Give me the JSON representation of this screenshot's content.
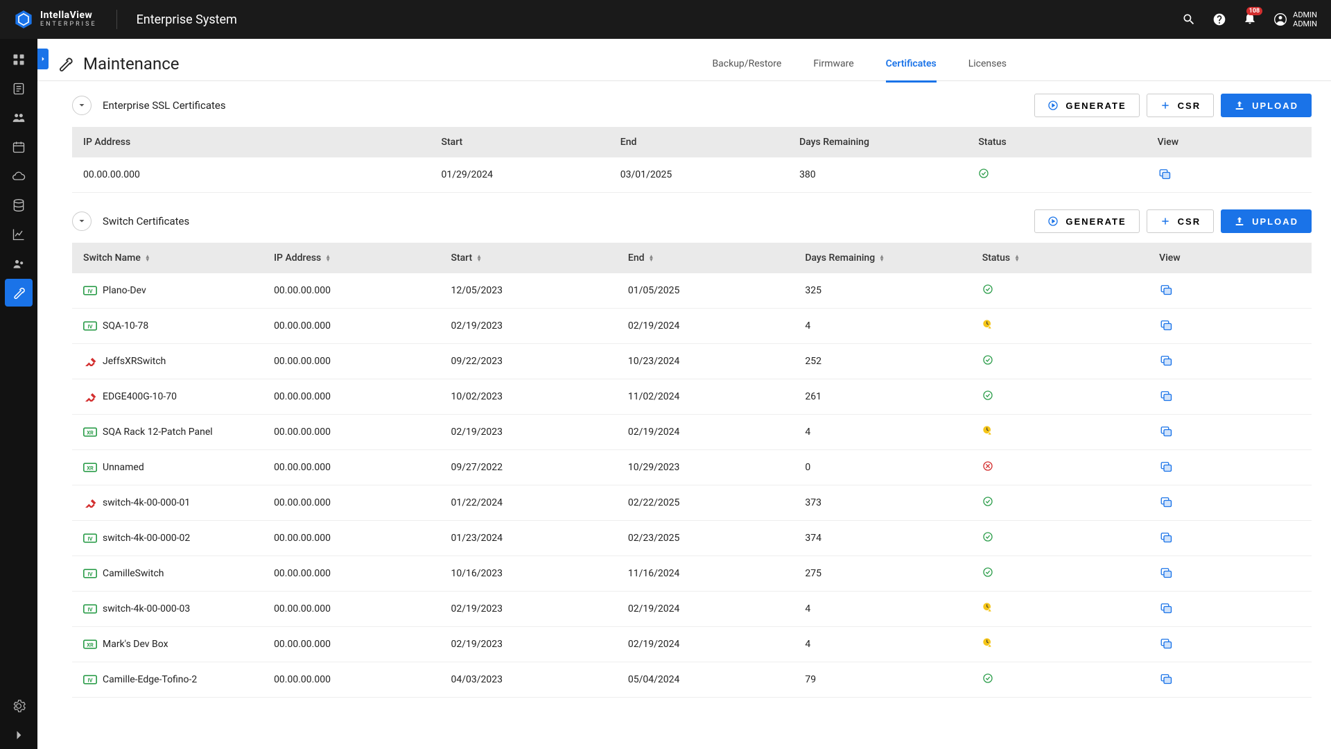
{
  "brand": {
    "name": "IntellaView",
    "sub": "ENTERPRISE"
  },
  "header": {
    "title": "Enterprise System",
    "notif_count": "108"
  },
  "user": {
    "line1": "ADMIN",
    "line2": "ADMIN"
  },
  "page": {
    "title": "Maintenance"
  },
  "tabs": {
    "backup": "Backup/Restore",
    "firmware": "Firmware",
    "certificates": "Certificates",
    "licenses": "Licenses"
  },
  "buttons": {
    "generate": "GENERATE",
    "csr": "CSR",
    "upload": "UPLOAD"
  },
  "sections": {
    "enterprise": {
      "title": "Enterprise SSL Certificates",
      "headers": {
        "ip": "IP Address",
        "start": "Start",
        "end": "End",
        "days": "Days Remaining",
        "status": "Status",
        "view": "View"
      },
      "rows": [
        {
          "ip": "00.00.00.000",
          "start": "01/29/2024",
          "end": "03/01/2025",
          "days": "380",
          "status": "ok"
        }
      ]
    },
    "switch": {
      "title": "Switch Certificates",
      "headers": {
        "switch": "Switch Name",
        "ip": "IP Address",
        "start": "Start",
        "end": "End",
        "days": "Days Remaining",
        "status": "Status",
        "view": "View"
      },
      "rows": [
        {
          "icon": "iv-green",
          "name": "Plano-Dev",
          "ip": "00.00.00.000",
          "start": "12/05/2023",
          "end": "01/05/2025",
          "days": "325",
          "status": "ok"
        },
        {
          "icon": "iv-green",
          "name": "SQA-10-78",
          "ip": "00.00.00.000",
          "start": "02/19/2023",
          "end": "02/19/2024",
          "days": "4",
          "status": "warn"
        },
        {
          "icon": "plug-red",
          "name": "JeffsXRSwitch",
          "ip": "00.00.00.000",
          "start": "09/22/2023",
          "end": "10/23/2024",
          "days": "252",
          "status": "ok"
        },
        {
          "icon": "plug-red",
          "name": "EDGE400G-10-70",
          "ip": "00.00.00.000",
          "start": "10/02/2023",
          "end": "11/02/2024",
          "days": "261",
          "status": "ok"
        },
        {
          "icon": "xr-green",
          "name": "SQA Rack 12-Patch Panel",
          "ip": "00.00.00.000",
          "start": "02/19/2023",
          "end": "02/19/2024",
          "days": "4",
          "status": "warn"
        },
        {
          "icon": "xr-green",
          "name": "Unnamed",
          "ip": "00.00.00.000",
          "start": "09/27/2022",
          "end": "10/29/2023",
          "days": "0",
          "status": "error"
        },
        {
          "icon": "plug-red",
          "name": "switch-4k-00-000-01",
          "ip": "00.00.00.000",
          "start": "01/22/2024",
          "end": "02/22/2025",
          "days": "373",
          "status": "ok"
        },
        {
          "icon": "iv-green",
          "name": "switch-4k-00-000-02",
          "ip": "00.00.00.000",
          "start": "01/23/2024",
          "end": "02/23/2025",
          "days": "374",
          "status": "ok"
        },
        {
          "icon": "iv-green",
          "name": "CamilleSwitch",
          "ip": "00.00.00.000",
          "start": "10/16/2023",
          "end": "11/16/2024",
          "days": "275",
          "status": "ok"
        },
        {
          "icon": "iv-green",
          "name": "switch-4k-00-000-03",
          "ip": "00.00.00.000",
          "start": "02/19/2023",
          "end": "02/19/2024",
          "days": "4",
          "status": "warn"
        },
        {
          "icon": "xr-green",
          "name": "Mark's Dev Box",
          "ip": "00.00.00.000",
          "start": "02/19/2023",
          "end": "02/19/2024",
          "days": "4",
          "status": "warn"
        },
        {
          "icon": "iv-green",
          "name": "Camille-Edge-Tofino-2",
          "ip": "00.00.00.000",
          "start": "04/03/2023",
          "end": "05/04/2024",
          "days": "79",
          "status": "ok"
        }
      ]
    }
  }
}
